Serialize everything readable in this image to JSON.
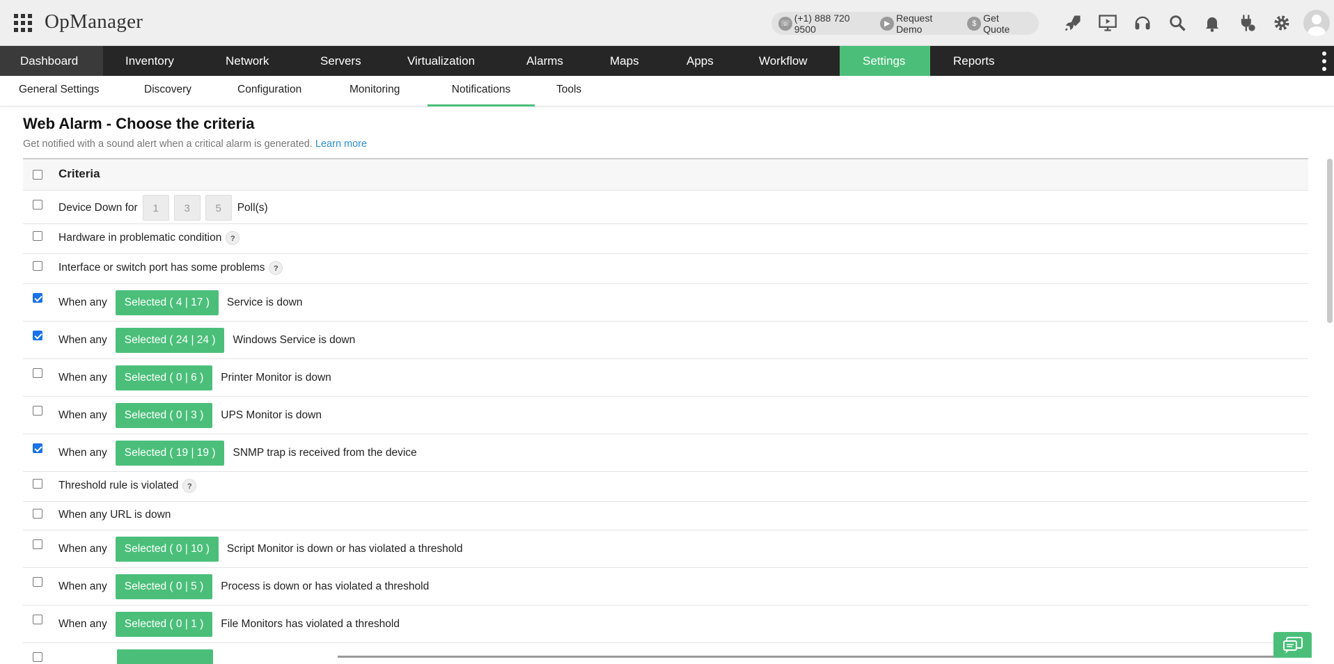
{
  "app": {
    "logo": "OpManager",
    "phone": "(+1) 888 720 9500",
    "request_demo": "Request Demo",
    "get_quote": "Get Quote"
  },
  "top_icons": [
    "rocket-icon",
    "presentation-icon",
    "headset-icon",
    "search-icon",
    "bell-icon",
    "plug-icon",
    "gear-icon"
  ],
  "mainnav": [
    {
      "label": "Dashboard"
    },
    {
      "label": "Inventory"
    },
    {
      "label": "Network"
    },
    {
      "label": "Servers"
    },
    {
      "label": "Virtualization"
    },
    {
      "label": "Alarms"
    },
    {
      "label": "Maps"
    },
    {
      "label": "Apps"
    },
    {
      "label": "Workflow"
    },
    {
      "label": "Settings",
      "active": true
    },
    {
      "label": "Reports"
    }
  ],
  "subnav": [
    {
      "label": "General Settings"
    },
    {
      "label": "Discovery"
    },
    {
      "label": "Configuration"
    },
    {
      "label": "Monitoring"
    },
    {
      "label": "Notifications",
      "active": true
    },
    {
      "label": "Tools"
    }
  ],
  "page": {
    "title": "Web Alarm - Choose the criteria",
    "subtitle": "Get notified with a sound alert when a critical alarm is generated.",
    "learn_more": "Learn more"
  },
  "table": {
    "header": "Criteria",
    "rows": [
      {
        "type": "poll",
        "text": "Device Down for",
        "polls": [
          "1",
          "3",
          "5"
        ],
        "suffix": "Poll(s)",
        "checked": false
      },
      {
        "type": "help",
        "text": "Hardware in problematic condition",
        "help": "?",
        "checked": false
      },
      {
        "type": "help",
        "text": "Interface or switch port has some problems",
        "help": "?",
        "checked": false
      },
      {
        "type": "selector",
        "prefix": "When any",
        "button": "Selected ( 4 | 17 )",
        "text": "Service is down",
        "checked": true
      },
      {
        "type": "selector",
        "prefix": "When any",
        "button": "Selected ( 24 | 24 )",
        "text": "Windows Service is down",
        "checked": true
      },
      {
        "type": "selector",
        "prefix": "When any",
        "button": "Selected ( 0 | 6 )",
        "text": "Printer Monitor is down",
        "checked": false
      },
      {
        "type": "selector",
        "prefix": "When any",
        "button": "Selected ( 0 | 3 )",
        "text": "UPS Monitor is down",
        "checked": false
      },
      {
        "type": "selector",
        "prefix": "When any",
        "button": "Selected ( 19 | 19 )",
        "text": "SNMP trap is received from the device",
        "checked": true
      },
      {
        "type": "help",
        "text": "Threshold rule is violated",
        "help": "?",
        "checked": false
      },
      {
        "type": "plain",
        "text": "When any URL is down",
        "checked": false
      },
      {
        "type": "selector",
        "prefix": "When any",
        "button": "Selected ( 0 | 10 )",
        "text": "Script Monitor is down or has violated a threshold",
        "checked": false
      },
      {
        "type": "selector",
        "prefix": "When any",
        "button": "Selected ( 0 | 5 )",
        "text": "Process is down or has violated a threshold",
        "checked": false
      },
      {
        "type": "selector",
        "prefix": "When any",
        "button": "Selected ( 0 | 1 )",
        "text": "File Monitors has violated a threshold",
        "checked": false
      }
    ]
  },
  "colors": {
    "accent": "#4bbf7a",
    "nav_bg": "#262626",
    "link": "#2b8fd6",
    "checkbox": "#1a73e8"
  }
}
